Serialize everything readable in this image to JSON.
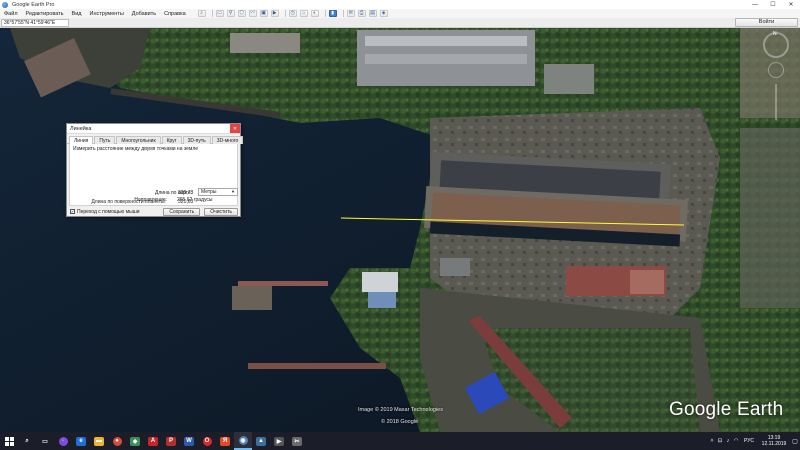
{
  "window": {
    "title": "Google Earth Pro"
  },
  "menu": [
    "Файл",
    "Редактировать",
    "Вид",
    "Инструменты",
    "Добавить",
    "Справка"
  ],
  "coordinates": "36°57'55\"N  41°59'46\"E",
  "login_label": "Войти",
  "ruler": {
    "title": "Линейка",
    "tabs": [
      "Линия",
      "Путь",
      "Многоугольник",
      "Круг",
      "3D-путь",
      "3D-много"
    ],
    "instructions": "Измерить расстояние между двумя точками на земле",
    "map_length_label": "Длина по карте:",
    "map_length_value": "320,73",
    "unit": "Метры",
    "ground_length_label": "Длина по поверхности планеты:",
    "ground_length_value": "321,63",
    "heading_label": "Направление:",
    "heading_value": "265,62 градусы",
    "mouse_nav_label": "Переход с помощью мыши",
    "save_label": "Сохранить",
    "clear_label": "Очистить"
  },
  "map": {
    "copyright_line1": "Image © 2019 Maxar Technologies",
    "copyright_line2": "© 2018 Google",
    "brand": "Google Earth",
    "compass_label": "N",
    "measure_line_color": "#ffff33"
  },
  "taskbar": {
    "language": "РУС",
    "time": "13:19",
    "date": "12.11.2019"
  }
}
